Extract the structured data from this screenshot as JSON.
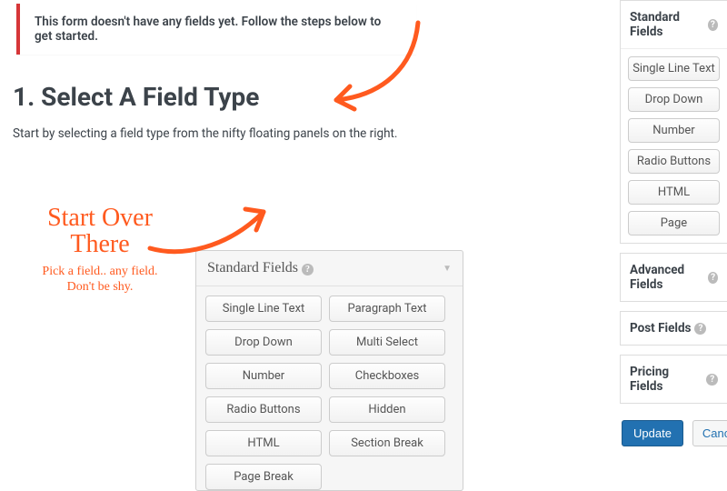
{
  "notice": "This form doesn't have any fields yet. Follow the steps below to get started.",
  "heading": "1. Select A Field Type",
  "subtext": "Start by selecting a field type from the nifty floating panels on the right.",
  "annotation": {
    "line1": "Start Over",
    "line2": "There",
    "sub1": "Pick a field.. any field.",
    "sub2": "Don't be shy."
  },
  "demo_panel": {
    "title": "Standard Fields",
    "buttons": [
      "Single Line Text",
      "Paragraph Text",
      "Drop Down",
      "Multi Select",
      "Number",
      "Checkboxes",
      "Radio Buttons",
      "Hidden",
      "HTML",
      "Section Break",
      "Page Break"
    ]
  },
  "sidebar": {
    "standard": {
      "title": "Standard Fields",
      "buttons": [
        "Single Line Text",
        "Drop Down",
        "Number",
        "Radio Buttons",
        "HTML",
        "Page"
      ]
    },
    "advanced": {
      "title": "Advanced Fields"
    },
    "post": {
      "title": "Post Fields"
    },
    "pricing": {
      "title": "Pricing Fields"
    }
  },
  "actions": {
    "update": "Update",
    "cancel": "Cancel"
  }
}
